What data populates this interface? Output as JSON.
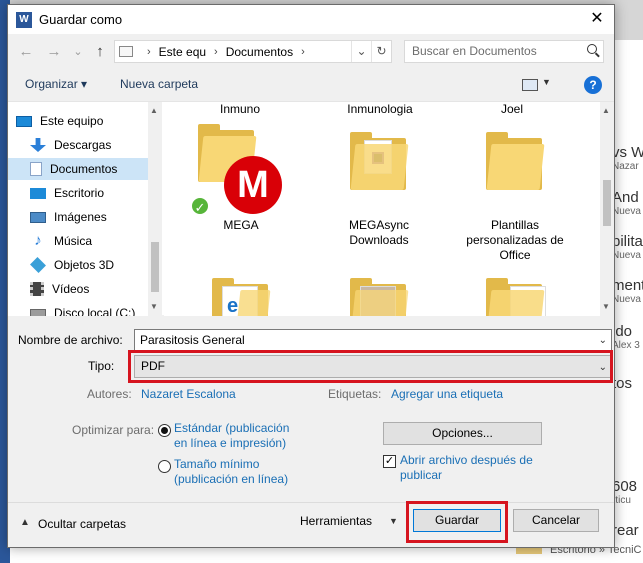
{
  "background": {
    "items": [
      {
        "title": "vs W",
        "sub": "Nazar"
      },
      {
        "title": "And",
        "sub": "Nueva"
      },
      {
        "title": "bilita",
        "sub": "Nueva"
      },
      {
        "title": "ment",
        "sub": "Nueva"
      },
      {
        "title": "ido",
        "sub": "Alex 3"
      },
      {
        "title": "tos",
        "sub": ""
      },
      {
        "title": "608",
        "sub": "rticu"
      },
      {
        "title": "rear",
        "sub": ""
      }
    ],
    "footer_path": "Escritorio » TecniC"
  },
  "window": {
    "title": "Guardar como",
    "app_icon_letter": "W",
    "close_glyph": "✕"
  },
  "nav": {
    "back_glyph": "←",
    "forward_glyph": "→",
    "recent_glyph": "⌄",
    "up_glyph": "↑",
    "breadcrumb": [
      "Este equ",
      "Documentos"
    ],
    "crumb_separator": "›",
    "dropdown_glyph": "⌄",
    "refresh_glyph": "↻",
    "search_placeholder": "Buscar en Documentos"
  },
  "toolbar": {
    "organize": "Organizar ▾",
    "new_folder": "Nueva carpeta",
    "help": "?"
  },
  "sidebar": {
    "root": "Este equipo",
    "items": [
      {
        "label": "Descargas",
        "icon": "download-icon",
        "color": "#2a7fd8"
      },
      {
        "label": "Documentos",
        "icon": "documents-icon",
        "color": "#8aa4c8",
        "selected": true
      },
      {
        "label": "Escritorio",
        "icon": "desktop-icon",
        "color": "#1c8ad8"
      },
      {
        "label": "Imágenes",
        "icon": "images-icon",
        "color": "#4c8bc7"
      },
      {
        "label": "Música",
        "icon": "music-icon",
        "color": "#2a7fd8"
      },
      {
        "label": "Objetos 3D",
        "icon": "objects3d-icon",
        "color": "#3aa0d8"
      },
      {
        "label": "Vídeos",
        "icon": "videos-icon",
        "color": "#444444"
      },
      {
        "label": "Disco local (C:)",
        "icon": "drive-icon",
        "color": "#777777"
      }
    ]
  },
  "files": {
    "top_row": [
      "Inmuno",
      "Inmunologia",
      "Joel"
    ],
    "items": [
      {
        "name": "MEGA",
        "type": "mega"
      },
      {
        "name": "MEGAsync Downloads",
        "type": "folder"
      },
      {
        "name": "Plantillas personalizadas de Office",
        "type": "folder"
      }
    ]
  },
  "form": {
    "filename_label": "Nombre de archivo:",
    "filename_value": "Parasitosis General",
    "type_label": "Tipo:",
    "type_value": "PDF",
    "authors_label": "Autores:",
    "authors_value": "Nazaret Escalona",
    "tags_label": "Etiquetas:",
    "tags_value": "Agregar una etiqueta",
    "optimize_label": "Optimizar para:",
    "opt_standard": "Estándar (publicación en línea e impresión)",
    "opt_minimum": "Tamaño mínimo (publicación en línea)",
    "options_button": "Opciones...",
    "open_after_label": "Abrir archivo después de publicar",
    "open_after_checked": "✓"
  },
  "footer": {
    "hide_folders": "Ocultar carpetas",
    "tools": "Herramientas",
    "save": "Guardar",
    "cancel": "Cancelar"
  },
  "colors": {
    "highlight": "#d6141f",
    "link": "#1a6fb5",
    "selection": "#cce4f7"
  }
}
